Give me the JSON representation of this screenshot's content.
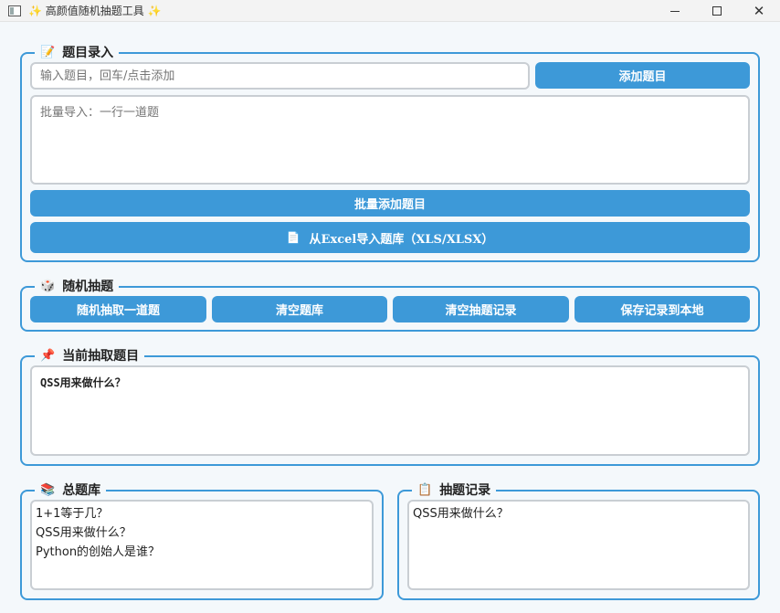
{
  "window": {
    "title": "✨ 高颜值随机抽题工具 ✨",
    "controls": {
      "minimize": "—",
      "maximize": "□",
      "close": "✕"
    }
  },
  "entry_group": {
    "title": "题目录入",
    "icon": "📝",
    "question_input": {
      "placeholder": "输入题目，回车/点击添加",
      "value": ""
    },
    "add_button": "添加题目",
    "batch_input": {
      "placeholder": "批量导入：一行一道题",
      "value": ""
    },
    "batch_button": "批量添加题目",
    "excel_button": {
      "icon": "📄",
      "label": "从Excel导入题库（XLS/XLSX）"
    }
  },
  "draw_group": {
    "title": "随机抽题",
    "icon": "🎲",
    "buttons": [
      "随机抽取一道题",
      "清空题库",
      "清空抽题记录",
      "保存记录到本地"
    ]
  },
  "current_group": {
    "title": "当前抽取题目",
    "icon": "📌",
    "question": "QSS用来做什么？"
  },
  "bank_group": {
    "title": "总题库",
    "icon": "📚",
    "items": [
      "1+1等于几？",
      "QSS用来做什么？",
      "Python的创始人是谁？"
    ]
  },
  "history_group": {
    "title": "抽题记录",
    "icon": "📋",
    "items": [
      "QSS用来做什么？"
    ]
  },
  "colors": {
    "accent": "#3d99d8",
    "background": "#f4f8fb",
    "input_border": "#c9ced3"
  }
}
